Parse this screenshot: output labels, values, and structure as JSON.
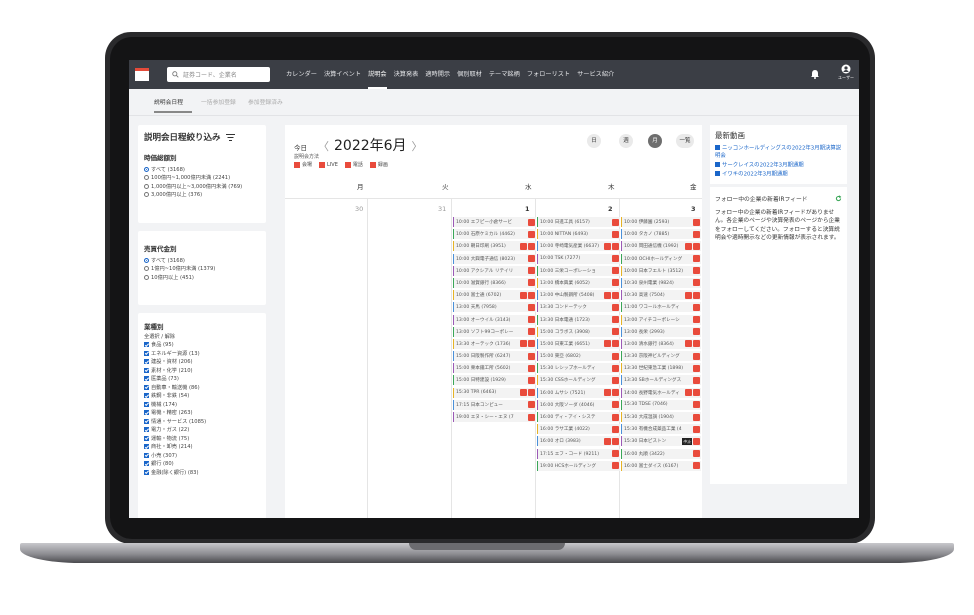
{
  "topbar": {
    "search_placeholder": "証券コード、企業名",
    "nav": [
      "カレンダー",
      "決算イベント",
      "説明会",
      "決算発表",
      "適時開示",
      "個別取材",
      "テーマ銘柄",
      "フォローリスト",
      "サービス紹介"
    ],
    "active_nav": "説明会",
    "user_label": "ユーザー"
  },
  "subtabs": [
    "説明会日程",
    "一括参加登録",
    "参加登録済み"
  ],
  "filter": {
    "title": "説明会日程絞り込み",
    "sections": [
      {
        "title": "時価総額別",
        "type": "radio",
        "options": [
          "すべて (3168)",
          "100億円~1,000億円未満 (2241)",
          "1,000億円以上~3,000億円未満 (769)",
          "3,000億円以上 (376)"
        ]
      },
      {
        "title": "売買代金別",
        "type": "radio",
        "options": [
          "すべて (3168)",
          "1億円~10億円未満 (1379)",
          "10億円以上 (451)"
        ]
      },
      {
        "title": "業種別",
        "subtitle": "全選択 / 解除",
        "type": "check",
        "options": [
          "食品 (95)",
          "エネルギー資源 (13)",
          "建設・資材 (206)",
          "素材・化学 (210)",
          "医薬品 (73)",
          "自動車・輸送機 (86)",
          "鉄鋼・非鉄 (54)",
          "機械 (174)",
          "電機・精密 (263)",
          "情通・サービス (1085)",
          "電力・ガス (22)",
          "運輸・物流 (75)",
          "商社・卸売 (214)",
          "小売 (307)",
          "銀行 (80)",
          "金融(除く銀行) (83)"
        ]
      }
    ]
  },
  "calendar": {
    "today": "今日",
    "prev": "〈",
    "next": "〉",
    "month": "2022年6月",
    "method_label": "説明会方法",
    "legend": [
      "会場",
      "LIVE",
      "電話",
      "録画"
    ],
    "views": [
      "日",
      "週",
      "月",
      "一覧"
    ],
    "active_view": "月",
    "weekdays": [
      "月",
      "火",
      "水",
      "木",
      "金"
    ],
    "days": [
      "30",
      "31",
      "1",
      "2",
      "3"
    ],
    "wed_events": [
      "10:00 エフピー小倉サービ",
      "10:00 石原ケミカル (4462)",
      "10:00 朝日印刷 (3951)",
      "10:00 大興電子通信 (8023)",
      "10:00 アクシアル リテイリ",
      "10:00 滋賀銀行 (8366)",
      "10:00 富士通 (6702)",
      "13:00 天馬 (7958)",
      "13:00 オーウイル (3143)",
      "13:00 ソフト99コーポレー",
      "13:30 オーテック (1736)",
      "15:00 日阪製作所 (6247)",
      "15:00 栗本鐵工所 (5602)",
      "15:00 日特建設 (1929)",
      "15:30 TPR (6463)",
      "17:15 日本コンピュー",
      "19:00 エヌ・シー・エヌ (7"
    ],
    "thu_events": [
      "10:00 日進工具 (6157)",
      "10:00 NITTAN (6493)",
      "10:00 寺崎電気産業 (6637)",
      "10:00 TSK (7277)",
      "10:00 三栄コーポレーショ",
      "13:00 橋本興業 (6052)",
      "13:00 中山製鋼所 (5408)",
      "13:30 コンドーテック",
      "13:30 日本電通 (1723)",
      "15:00 コラボス (3908)",
      "15:00 日東工業 (6651)",
      "15:00 東亞 (6802)",
      "15:30 レシップホールディ",
      "15:30 CSSホールディング",
      "16:00 ムサシ (7521)",
      "16:00 大阪ソーダ (4046)",
      "16:00 ディ・アイ・システ",
      "16:00 ラサ工業 (4022)",
      "16:00 オロ (3983)",
      "17:15 エフ・コード (9211)",
      "19:00 HCSホールディング"
    ],
    "fri_events": [
      "10:00 伊藤園 (2593)",
      "10:00 タカノ (7885)",
      "10:00 岡田通信機 (1992)",
      "10:00 OCHIホールディング",
      "10:00 日本フエルト (3512)",
      "10:30 泉州電業 (9824)",
      "10:30 高速 (7504)",
      "11:00 ワコールホールディ",
      "13:00 アイチコーポレーシ",
      "13:00 長栄 (2993)",
      "13:00 清水銀行 (8364)",
      "13:30 京阪神ビルディング",
      "13:30 世紀東急工業 (1898)",
      "13:30 SBホールディングス",
      "14:00 長野電気ホールディ",
      "15:30 TDSE (7046)",
      "15:30 大成温調 (1904)",
      "15:30 有機合成薬品工業 (4",
      "15:30 日本ピストン",
      "16:00 丸順 (3422)",
      "16:00 富士ダイス (6167)"
    ],
    "fri_chushi_label": "中止"
  },
  "right": {
    "latest_title": "最新動画",
    "links": [
      "ニッコンホールディングスの2022年3月期決算説明会",
      "サークレイスの2022年3月期通期",
      "イワキの2022年3月期通期"
    ],
    "feed_title": "フォロー中の企業の新着IRフィード",
    "feed_body": "フォロー中の企業の新着IRフィードがありません。各企業のページや決算発表のページから企業をフォローしてください。フォローすると決算説明会や適時開示などの更新情報が表示されます。"
  },
  "colors": {
    "topbar": "#3b3e45",
    "accent": "#e94b3c",
    "link": "#1a66c9"
  }
}
